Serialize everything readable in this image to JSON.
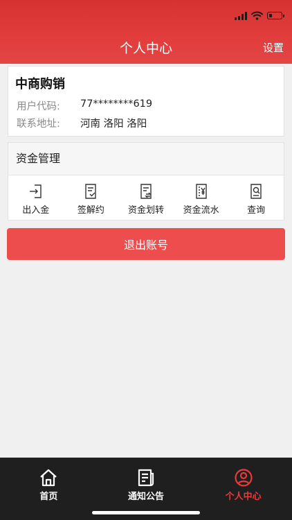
{
  "header": {
    "title": "个人中心",
    "settings": "设置"
  },
  "profile": {
    "company": "中商购销",
    "user_code_label": "用户代码:",
    "user_code": "77********619",
    "address_label": "联系地址:",
    "address": "河南 洛阳 洛阳"
  },
  "funds": {
    "title": "资金管理",
    "items": [
      {
        "label": "出入金",
        "icon": "deposit-withdraw-icon"
      },
      {
        "label": "签解约",
        "icon": "sign-contract-icon"
      },
      {
        "label": "资金划转",
        "icon": "fund-transfer-icon"
      },
      {
        "label": "资金流水",
        "icon": "fund-ledger-icon"
      },
      {
        "label": "查询",
        "icon": "query-icon"
      }
    ]
  },
  "logout": "退出账号",
  "tabbar": {
    "items": [
      {
        "label": "首页",
        "icon": "home-icon"
      },
      {
        "label": "通知公告",
        "icon": "notice-icon"
      },
      {
        "label": "个人中心",
        "icon": "user-circle-icon",
        "active": true
      }
    ]
  },
  "colors": {
    "primary": "#e13d3d",
    "tab_active": "#ea3a3a",
    "tabbar_bg": "#1f1f1f"
  }
}
